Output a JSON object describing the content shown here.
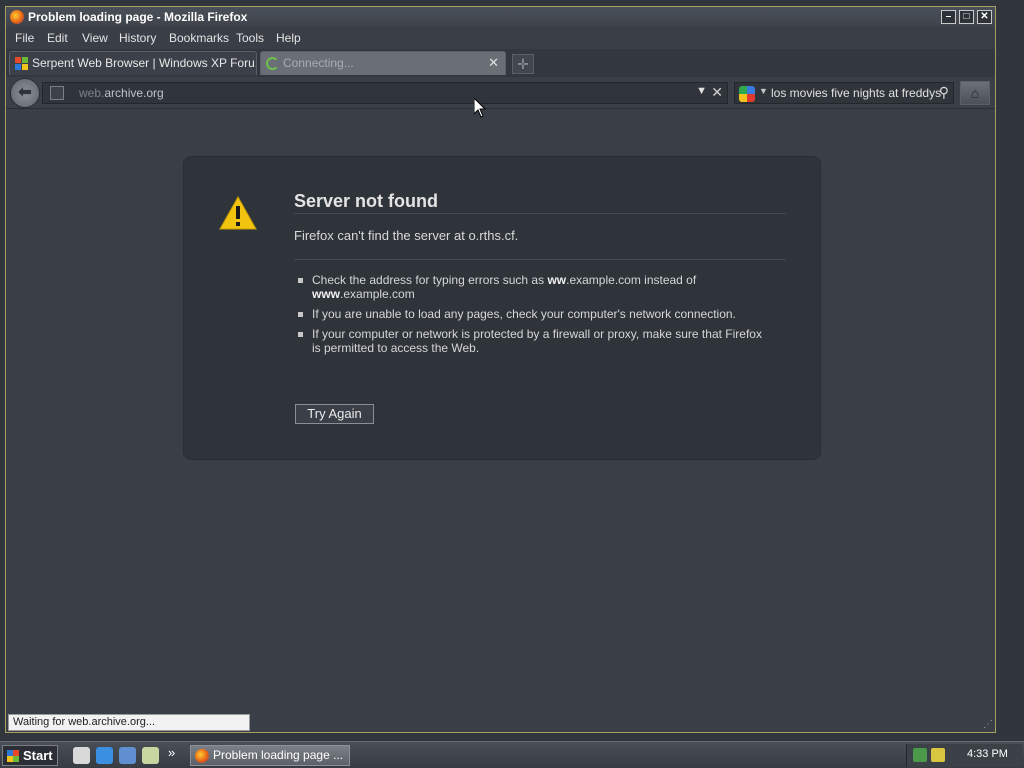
{
  "window": {
    "title": "Problem loading page - Mozilla Firefox",
    "controls": [
      "minimize",
      "maximize",
      "close"
    ]
  },
  "menubar": [
    "File",
    "Edit",
    "View",
    "History",
    "Bookmarks",
    "Tools",
    "Help"
  ],
  "tabs": [
    {
      "label": "Serpent Web Browser | Windows XP Foru...",
      "icon": "forum-favicon",
      "active": false
    },
    {
      "label": "Connecting...",
      "icon": "loading-spinner-icon",
      "active": true
    }
  ],
  "navbar": {
    "url_prefix": "web.",
    "url_rest": "archive.org",
    "search_text": "los movies five nights at freddys",
    "search_engine_icon": "google-icon"
  },
  "error": {
    "title": "Server not found",
    "short_desc": "Firefox can't find the server at o.rths.cf.",
    "tips": [
      {
        "pre": "Check the address for typing errors such as ",
        "b1": "ww",
        "mid": ".example.com instead of ",
        "b2": "www",
        "post": ".example.com"
      },
      {
        "text": "If you are unable to load any pages, check your computer's network connection."
      },
      {
        "text": "If your computer or network is protected by a firewall or proxy, make sure that Firefox is permitted to access the Web."
      }
    ],
    "try_again_label": "Try Again"
  },
  "status": {
    "text": "Waiting for web.archive.org..."
  },
  "taskbar": {
    "start_label": "Start",
    "task_label": "Problem loading page ...",
    "clock": "4:33 PM"
  },
  "colors": {
    "accent_warning": "#f2c40f",
    "content_bg": "#3a3f47",
    "error_box_bg": "#2f343b"
  }
}
